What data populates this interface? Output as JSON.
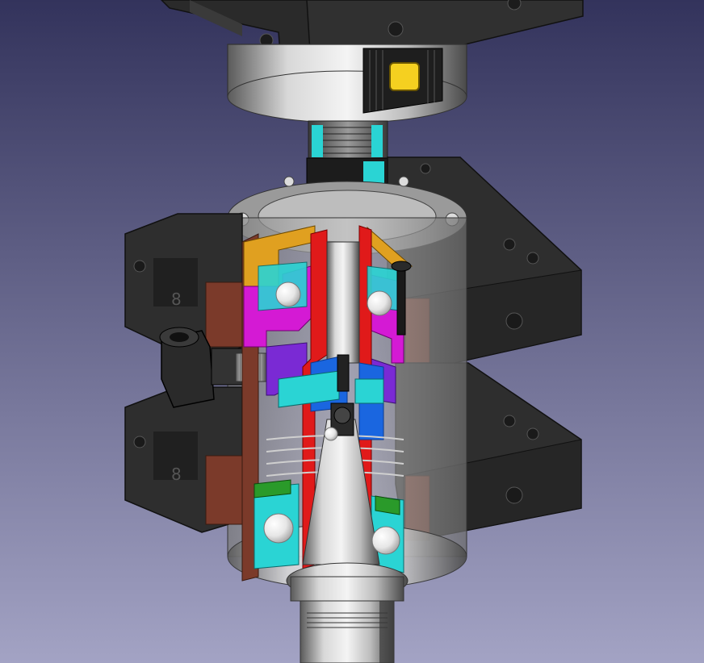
{
  "viewport": {
    "background_top_color": "#33335c",
    "background_bottom_color": "#a3a3c4"
  },
  "model": {
    "engraving_mark_1": "8",
    "engraving_mark_2": "8",
    "colors": {
      "body_gray": "#6e6e6e",
      "dark_block": "#2d2d2d",
      "brown_pad": "#7b3a2a",
      "orange": "#e0a020",
      "magenta": "#d41ad4",
      "purple": "#7a2ad4",
      "cyan": "#2ad4d4",
      "blue": "#1a66e0",
      "red": "#e01a1a",
      "green": "#2a9a2a",
      "yellow_button": "#f5d020",
      "ball_white": "#f2f2f2"
    }
  }
}
